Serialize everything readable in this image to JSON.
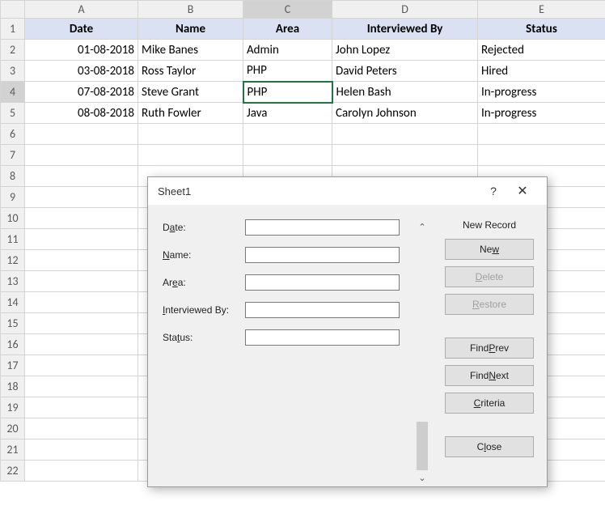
{
  "columns": [
    "A",
    "B",
    "C",
    "D",
    "E"
  ],
  "rows": [
    "1",
    "2",
    "3",
    "4",
    "5",
    "6",
    "7",
    "8",
    "9",
    "10",
    "11",
    "12",
    "13",
    "14",
    "15",
    "16",
    "17",
    "18",
    "19",
    "20",
    "21",
    "22"
  ],
  "headers": {
    "A": "Date",
    "B": "Name",
    "C": "Area",
    "D": "Interviewed By",
    "E": "Status"
  },
  "data": [
    {
      "A": "01-08-2018",
      "B": "Mike Banes",
      "C": "Admin",
      "D": "John Lopez",
      "E": "Rejected"
    },
    {
      "A": "03-08-2018",
      "B": "Ross Taylor",
      "C": "PHP",
      "D": "David Peters",
      "E": "Hired"
    },
    {
      "A": "07-08-2018",
      "B": "Steve Grant",
      "C": "PHP",
      "D": "Helen Bash",
      "E": "In-progress"
    },
    {
      "A": "08-08-2018",
      "B": "Ruth Fowler",
      "C": "Java",
      "D": "Carolyn Johnson",
      "E": "In-progress"
    }
  ],
  "selected": {
    "col": "C",
    "row": 4
  },
  "dialog": {
    "title": "Sheet1",
    "help_symbol": "?",
    "close_symbol": "✕",
    "record_label": "New Record",
    "fields": {
      "date": {
        "prefix": "D",
        "ul": "a",
        "suffix": "te:",
        "value": ""
      },
      "name": {
        "prefix": "",
        "ul": "N",
        "suffix": "ame:",
        "value": ""
      },
      "area": {
        "prefix": "Ar",
        "ul": "e",
        "suffix": "a:",
        "value": ""
      },
      "intby": {
        "prefix": "",
        "ul": "I",
        "suffix": "nterviewed By:",
        "value": ""
      },
      "status": {
        "prefix": "Sta",
        "ul": "t",
        "suffix": "us:",
        "value": ""
      }
    },
    "buttons": {
      "new": {
        "prefix": "Ne",
        "ul": "w",
        "suffix": ""
      },
      "delete": {
        "prefix": "",
        "ul": "D",
        "suffix": "elete"
      },
      "restore": {
        "prefix": "",
        "ul": "R",
        "suffix": "estore"
      },
      "findprev": {
        "prefix": "Find ",
        "ul": "P",
        "suffix": "rev"
      },
      "findnext": {
        "prefix": "Find ",
        "ul": "N",
        "suffix": "ext"
      },
      "criteria": {
        "prefix": "",
        "ul": "C",
        "suffix": "riteria"
      },
      "close": {
        "prefix": "C",
        "ul": "l",
        "suffix": "ose"
      }
    },
    "scroll": {
      "up": "⌃",
      "down": "⌄"
    }
  }
}
